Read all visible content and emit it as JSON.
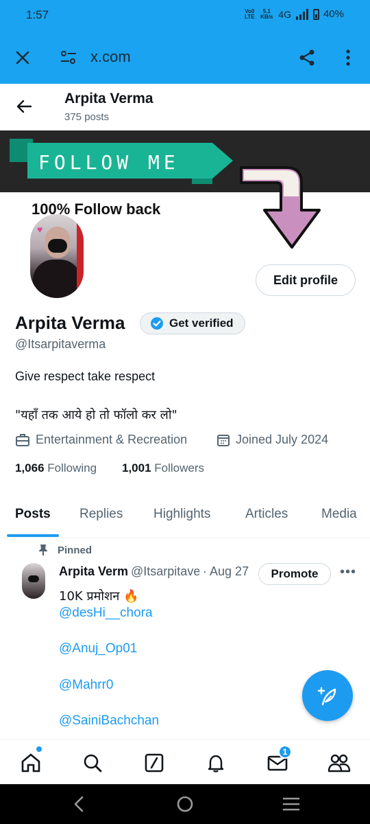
{
  "status_bar": {
    "time": "1:57",
    "volte": "Vo0 LTE",
    "speed": "5.1 KB/s",
    "network": "4G",
    "battery": "40%"
  },
  "browser": {
    "url": "x.com",
    "close_icon": "close-icon",
    "tune_icon": "site-settings-icon",
    "share_icon": "share-icon",
    "menu_icon": "more-vert-icon"
  },
  "header": {
    "name": "Arpita Verma",
    "posts": "375 posts"
  },
  "banner": {
    "text": "FOLLOW ME"
  },
  "avatar_text": "100% Follow back",
  "profile": {
    "edit_label": "Edit profile",
    "name": "Arpita Verma",
    "get_verified": "Get verified",
    "handle": "@Itsarpitaverma",
    "bio_line1": "Give respect take respect",
    "bio_line2": "\"यहाँ तक आये हो तो फॉलो कर लो\"",
    "category": "Entertainment & Recreation",
    "joined": "Joined July 2024",
    "following_count": "1,066",
    "following_label": "Following",
    "followers_count": "1,001",
    "followers_label": "Followers"
  },
  "tabs": [
    "Posts",
    "Replies",
    "Highlights",
    "Articles",
    "Media"
  ],
  "post": {
    "pinned_label": "Pinned",
    "name": "Arpita Verma",
    "handle": "@Itsarpitaverma",
    "date": "· Aug 27",
    "promote_label": "Promote",
    "text": "10K प्रमोशन 🔥",
    "mentions": [
      "@desHi__chora",
      "@Anuj_Op01",
      "@Mahrr0",
      "@SainiBachchan"
    ]
  },
  "nav": {
    "messages_badge": "1"
  },
  "colors": {
    "accent": "#1d9bf0",
    "chrome": "#1aa3f0"
  }
}
